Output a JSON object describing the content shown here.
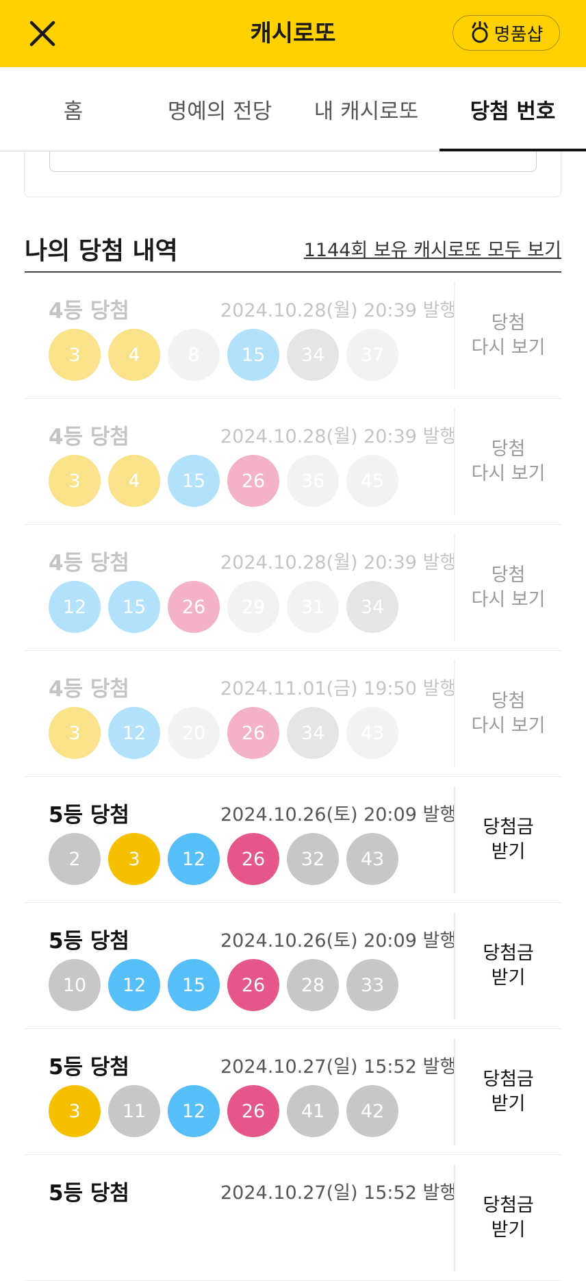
{
  "header": {
    "title": "캐시로또",
    "shop_label": "명품샵",
    "colors": {
      "background": "#FFD100"
    }
  },
  "tabs": [
    {
      "label": "홈",
      "active": false
    },
    {
      "label": "명예의 전당",
      "active": false
    },
    {
      "label": "내 캐시로또",
      "active": false
    },
    {
      "label": "당첨 번호",
      "active": true
    }
  ],
  "section": {
    "title": "나의 당첨 내역",
    "link": "1144회 보유 캐시로또 모두 보기"
  },
  "ball_colors": {
    "yellow": "#F5C000",
    "blue": "#56BFF7",
    "pink": "#E5578A",
    "gray": "#C7C7C7",
    "light": "#E4E4E4"
  },
  "tickets": [
    {
      "rank": "4등 당첨",
      "date": "2024.10.28(월) 20:39 발행",
      "state": "past",
      "action_line1": "당첨",
      "action_line2": "다시 보기",
      "numbers": [
        3,
        4,
        8,
        15,
        34,
        37
      ],
      "colors": [
        "yellow",
        "yellow",
        "light",
        "blue",
        "gray",
        "light"
      ]
    },
    {
      "rank": "4등 당첨",
      "date": "2024.10.28(월) 20:39 발행",
      "state": "past",
      "action_line1": "당첨",
      "action_line2": "다시 보기",
      "numbers": [
        3,
        4,
        15,
        26,
        36,
        45
      ],
      "colors": [
        "yellow",
        "yellow",
        "blue",
        "pink",
        "light",
        "light"
      ]
    },
    {
      "rank": "4등 당첨",
      "date": "2024.10.28(월) 20:39 발행",
      "state": "past",
      "action_line1": "당첨",
      "action_line2": "다시 보기",
      "numbers": [
        12,
        15,
        26,
        29,
        31,
        34
      ],
      "colors": [
        "blue",
        "blue",
        "pink",
        "light",
        "light",
        "gray"
      ]
    },
    {
      "rank": "4등 당첨",
      "date": "2024.11.01(금) 19:50 발행",
      "state": "past",
      "action_line1": "당첨",
      "action_line2": "다시 보기",
      "numbers": [
        3,
        12,
        20,
        26,
        34,
        43
      ],
      "colors": [
        "yellow",
        "blue",
        "light",
        "pink",
        "gray",
        "light"
      ]
    },
    {
      "rank": "5등 당첨",
      "date": "2024.10.26(토) 20:09 발행",
      "state": "active",
      "action_line1": "당첨금",
      "action_line2": "받기",
      "numbers": [
        2,
        3,
        12,
        26,
        32,
        43
      ],
      "colors": [
        "gray",
        "yellow",
        "blue",
        "pink",
        "gray",
        "gray"
      ]
    },
    {
      "rank": "5등 당첨",
      "date": "2024.10.26(토) 20:09 발행",
      "state": "active",
      "action_line1": "당첨금",
      "action_line2": "받기",
      "numbers": [
        10,
        12,
        15,
        26,
        28,
        33
      ],
      "colors": [
        "gray",
        "blue",
        "blue",
        "pink",
        "gray",
        "gray"
      ]
    },
    {
      "rank": "5등 당첨",
      "date": "2024.10.27(일) 15:52 발행",
      "state": "active",
      "action_line1": "당첨금",
      "action_line2": "받기",
      "numbers": [
        3,
        11,
        12,
        26,
        41,
        42
      ],
      "colors": [
        "yellow",
        "gray",
        "blue",
        "pink",
        "gray",
        "gray"
      ]
    },
    {
      "rank": "5등 당첨",
      "date": "2024.10.27(일) 15:52 발행",
      "state": "active",
      "action_line1": "당첨금",
      "action_line2": "받기",
      "numbers": [],
      "colors": []
    }
  ]
}
